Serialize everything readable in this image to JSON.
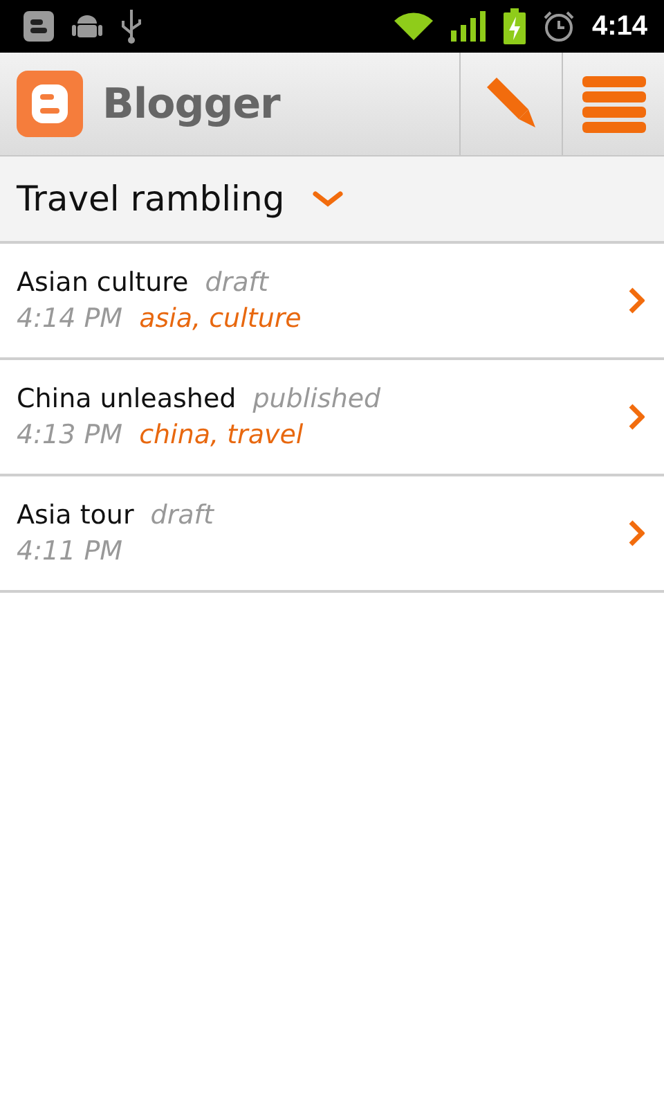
{
  "status_bar": {
    "time": "4:14"
  },
  "app_bar": {
    "title": "Blogger"
  },
  "blog_selector": {
    "label": "Travel rambling"
  },
  "posts": [
    {
      "title": "Asian culture",
      "status": "draft",
      "time": "4:14 PM",
      "labels": "asia, culture"
    },
    {
      "title": "China unleashed",
      "status": "published",
      "time": "4:13 PM",
      "labels": "china, travel"
    },
    {
      "title": "Asia tour",
      "status": "draft",
      "time": "4:11 PM"
    }
  ]
}
